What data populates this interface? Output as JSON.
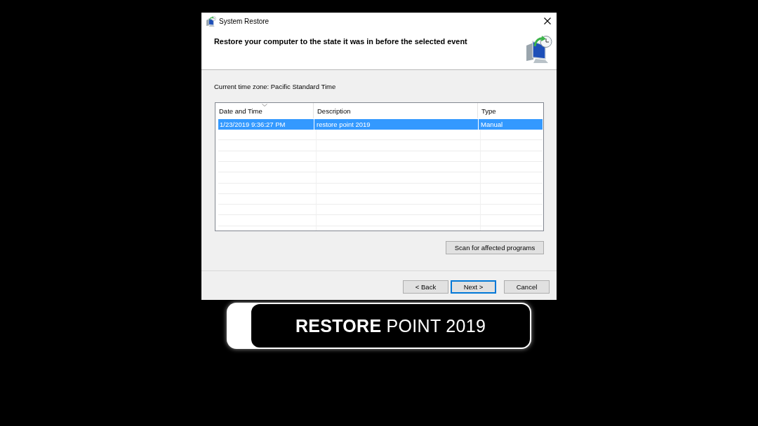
{
  "window": {
    "title": "System Restore"
  },
  "header": {
    "heading": "Restore your computer to the state it was in before the selected event"
  },
  "time_zone": "Current time zone: Pacific Standard Time",
  "table": {
    "columns": [
      {
        "label": "Date and Time",
        "sorted": true
      },
      {
        "label": "Description",
        "sorted": false
      },
      {
        "label": "Type",
        "sorted": false
      }
    ],
    "rows": [
      {
        "cells": [
          "1/23/2019 9:36:27 PM",
          "restore point 2019",
          "Manual"
        ],
        "selected": true
      }
    ]
  },
  "scan_button": "Scan for affected programs",
  "buttons": [
    {
      "label": "< Back",
      "focused": false
    },
    {
      "label": "Next >",
      "focused": true
    },
    {
      "label": "Cancel",
      "focused": false
    }
  ],
  "banner": {
    "text": "**RESTORE** POINT 2019"
  }
}
